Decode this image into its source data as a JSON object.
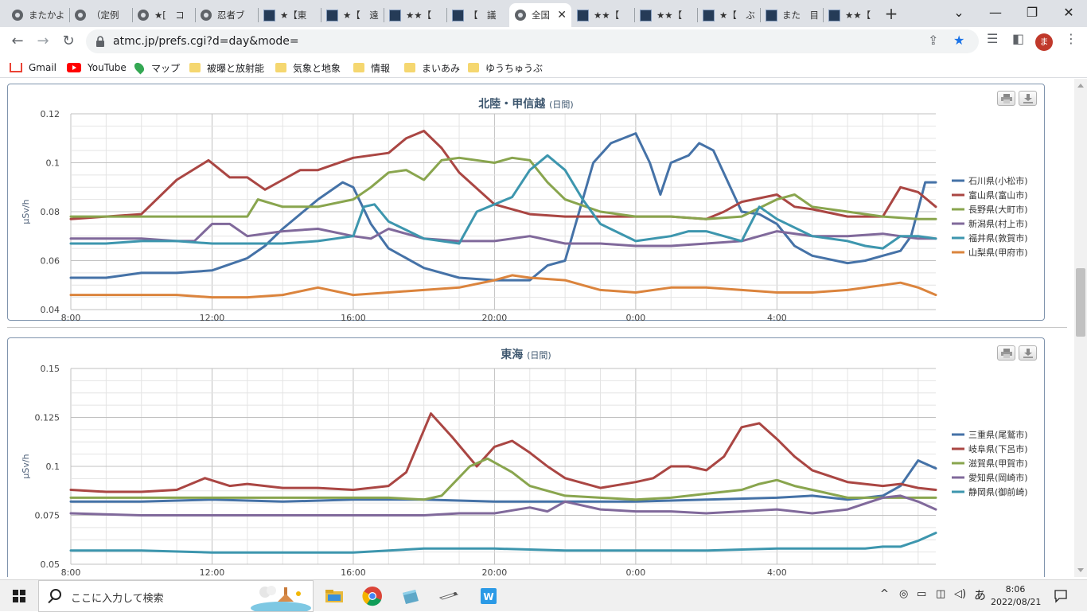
{
  "browser": {
    "tabs": [
      {
        "title": "またかよ",
        "icon": "globe-icon",
        "active": false
      },
      {
        "title": "（定例",
        "icon": "globe-icon",
        "active": false
      },
      {
        "title": "★[　コ",
        "icon": "globe-icon",
        "active": false
      },
      {
        "title": "忍者ブ",
        "icon": "globe-icon",
        "active": false
      },
      {
        "title": "★【東",
        "icon": "site-icon",
        "active": false
      },
      {
        "title": "★【　遠",
        "icon": "site-icon",
        "active": false
      },
      {
        "title": "★★【",
        "icon": "site-icon",
        "active": false
      },
      {
        "title": "【　議",
        "icon": "site-icon",
        "active": false
      },
      {
        "title": "全国",
        "icon": "globe-icon",
        "active": true
      },
      {
        "title": "★★【",
        "icon": "site-icon",
        "active": false
      },
      {
        "title": "★★【",
        "icon": "site-icon",
        "active": false
      },
      {
        "title": "★【　ぶ",
        "icon": "site-icon",
        "active": false
      },
      {
        "title": "また　目",
        "icon": "site-icon",
        "active": false
      },
      {
        "title": "★★【",
        "icon": "site-icon",
        "active": false
      }
    ],
    "url": "atmc.jp/prefs.cgi?d=day&mode=",
    "avatar_letter": "ま",
    "bookmarks": [
      {
        "label": "Gmail",
        "icon": "gmail-icon"
      },
      {
        "label": "YouTube",
        "icon": "youtube-icon"
      },
      {
        "label": "マップ",
        "icon": "maps-icon"
      },
      {
        "label": "被曝と放射能",
        "icon": "folder-icon"
      },
      {
        "label": "気象と地象",
        "icon": "folder-icon"
      },
      {
        "label": "情報",
        "icon": "folder-icon"
      },
      {
        "label": "まいあみ",
        "icon": "folder-icon"
      },
      {
        "label": "ゆうちゅうぶ",
        "icon": "folder-icon"
      }
    ]
  },
  "chart_data": [
    {
      "type": "line",
      "title": "北陸・甲信越",
      "subtitle": "(日間)",
      "ylabel": "µSv/h",
      "ylim": [
        0.04,
        0.12
      ],
      "yticks": [
        "0.12",
        "0.1",
        "0.08",
        "0.06",
        "0.04"
      ],
      "ytick_values": [
        0.12,
        0.1,
        0.08,
        0.06,
        0.04
      ],
      "xlim": [
        8,
        32.5
      ],
      "xtick_labels": [
        "8:00",
        "12:00",
        "16:00",
        "20:00",
        "0:00",
        "4:00"
      ],
      "xtick_hours": [
        8,
        12,
        16,
        20,
        24,
        28
      ],
      "legend_position": "right",
      "series": [
        {
          "name": "石川県(小松市)",
          "color": "#4572a7",
          "x": [
            8,
            9,
            10,
            11,
            12,
            13,
            13.5,
            14,
            15,
            15.7,
            16,
            16.5,
            17,
            18,
            19,
            20,
            21,
            21.5,
            22,
            22.8,
            23.3,
            24,
            24.4,
            24.7,
            25,
            25.5,
            25.8,
            26.2,
            27,
            27.5,
            28,
            28.5,
            29,
            30,
            30.5,
            31,
            31.5,
            31.8,
            32.2,
            32.5
          ],
          "y": [
            0.053,
            0.053,
            0.055,
            0.055,
            0.056,
            0.061,
            0.066,
            0.073,
            0.085,
            0.092,
            0.09,
            0.075,
            0.065,
            0.057,
            0.053,
            0.052,
            0.052,
            0.058,
            0.06,
            0.1,
            0.108,
            0.112,
            0.1,
            0.087,
            0.1,
            0.103,
            0.108,
            0.105,
            0.08,
            0.079,
            0.075,
            0.066,
            0.062,
            0.059,
            0.06,
            0.062,
            0.064,
            0.07,
            0.092,
            0.092
          ]
        },
        {
          "name": "富山県(富山市)",
          "color": "#aa4643",
          "x": [
            8,
            9,
            10,
            11,
            11.9,
            12.5,
            13,
            13.5,
            14,
            14.5,
            15,
            16,
            17,
            17.5,
            18,
            18.5,
            19,
            20,
            21,
            22,
            23,
            24,
            25,
            26,
            26.5,
            27,
            28,
            28.5,
            29,
            30,
            31,
            31.5,
            32,
            32.5
          ],
          "y": [
            0.077,
            0.078,
            0.079,
            0.093,
            0.101,
            0.094,
            0.094,
            0.089,
            0.093,
            0.097,
            0.097,
            0.102,
            0.104,
            0.11,
            0.113,
            0.106,
            0.096,
            0.083,
            0.079,
            0.078,
            0.078,
            0.078,
            0.078,
            0.077,
            0.08,
            0.084,
            0.087,
            0.082,
            0.081,
            0.078,
            0.078,
            0.09,
            0.088,
            0.082
          ]
        },
        {
          "name": "長野県(大町市)",
          "color": "#89a54e",
          "x": [
            8,
            9,
            10,
            11,
            12,
            13,
            13.3,
            14,
            15,
            16,
            16.5,
            17,
            17.5,
            18,
            18.5,
            19,
            20,
            20.5,
            21,
            21.5,
            22,
            23,
            24,
            25,
            26,
            27,
            28,
            28.5,
            29,
            30,
            31,
            32,
            32.5
          ],
          "y": [
            0.078,
            0.078,
            0.078,
            0.078,
            0.078,
            0.078,
            0.085,
            0.082,
            0.082,
            0.085,
            0.09,
            0.096,
            0.097,
            0.093,
            0.101,
            0.102,
            0.1,
            0.102,
            0.101,
            0.092,
            0.085,
            0.08,
            0.078,
            0.078,
            0.077,
            0.078,
            0.085,
            0.087,
            0.082,
            0.08,
            0.078,
            0.077,
            0.077
          ]
        },
        {
          "name": "新潟県(村上市)",
          "color": "#80699b",
          "x": [
            8,
            9,
            10,
            11,
            11.5,
            12,
            12.5,
            13,
            14,
            15,
            16,
            16.5,
            17,
            17.5,
            18,
            19,
            20,
            21,
            22,
            23,
            24,
            25,
            26,
            27,
            28,
            29,
            30,
            31,
            32,
            32.5
          ],
          "y": [
            0.069,
            0.069,
            0.069,
            0.068,
            0.068,
            0.075,
            0.075,
            0.07,
            0.072,
            0.073,
            0.07,
            0.069,
            0.073,
            0.071,
            0.069,
            0.068,
            0.068,
            0.07,
            0.067,
            0.067,
            0.066,
            0.066,
            0.067,
            0.068,
            0.072,
            0.07,
            0.07,
            0.071,
            0.069,
            0.069
          ]
        },
        {
          "name": "福井県(敦賀市)",
          "color": "#3d96ae",
          "x": [
            8,
            9,
            10,
            11,
            12,
            13,
            14,
            15,
            16,
            16.3,
            16.6,
            17,
            18,
            19,
            19.5,
            20,
            20.5,
            21,
            21.5,
            22,
            22.5,
            23,
            24,
            25,
            25.5,
            26,
            27,
            27.5,
            28,
            29,
            30,
            30.5,
            31,
            31.5,
            32,
            32.5
          ],
          "y": [
            0.067,
            0.067,
            0.068,
            0.068,
            0.067,
            0.067,
            0.067,
            0.068,
            0.07,
            0.082,
            0.083,
            0.076,
            0.069,
            0.067,
            0.08,
            0.083,
            0.086,
            0.097,
            0.103,
            0.097,
            0.085,
            0.075,
            0.068,
            0.07,
            0.072,
            0.072,
            0.068,
            0.082,
            0.077,
            0.07,
            0.068,
            0.066,
            0.065,
            0.07,
            0.07,
            0.069
          ]
        },
        {
          "name": "山梨県(甲府市)",
          "color": "#db843d",
          "x": [
            8,
            9,
            10,
            11,
            12,
            13,
            14,
            15,
            16,
            17,
            18,
            19,
            20,
            20.5,
            21,
            22,
            22.5,
            23,
            24,
            25,
            26,
            27,
            28,
            29,
            30,
            31,
            31.5,
            32,
            32.5
          ],
          "y": [
            0.046,
            0.046,
            0.046,
            0.046,
            0.045,
            0.045,
            0.046,
            0.049,
            0.046,
            0.047,
            0.048,
            0.049,
            0.052,
            0.054,
            0.053,
            0.052,
            0.05,
            0.048,
            0.047,
            0.049,
            0.049,
            0.048,
            0.047,
            0.047,
            0.048,
            0.05,
            0.051,
            0.049,
            0.046
          ]
        }
      ]
    },
    {
      "type": "line",
      "title": "東海",
      "subtitle": "(日間)",
      "ylabel": "µSv/h",
      "ylim": [
        0.05,
        0.15
      ],
      "yticks": [
        "0.15",
        "0.125",
        "0.1",
        "0.075",
        "0.05"
      ],
      "ytick_values": [
        0.15,
        0.125,
        0.1,
        0.075,
        0.05
      ],
      "xlim": [
        8,
        32.5
      ],
      "xtick_labels": [
        "8:00",
        "12:00",
        "16:00",
        "20:00",
        "0:00",
        "4:00"
      ],
      "xtick_hours": [
        8,
        12,
        16,
        20,
        24,
        28
      ],
      "legend_position": "right",
      "series": [
        {
          "name": "三重県(尾鷲市)",
          "color": "#4572a7",
          "x": [
            8,
            10,
            12,
            14,
            16,
            18,
            20,
            22,
            24,
            26,
            28,
            29,
            30,
            30.5,
            31,
            31.5,
            32,
            32.5
          ],
          "y": [
            0.082,
            0.082,
            0.083,
            0.082,
            0.083,
            0.083,
            0.082,
            0.082,
            0.082,
            0.083,
            0.084,
            0.085,
            0.083,
            0.084,
            0.085,
            0.09,
            0.103,
            0.099
          ]
        },
        {
          "name": "岐阜県(下呂市)",
          "color": "#aa4643",
          "x": [
            8,
            9,
            10,
            11,
            11.8,
            12.5,
            13,
            14,
            15,
            16,
            17,
            17.5,
            18.2,
            18.8,
            19.5,
            20,
            20.5,
            21,
            21.5,
            22,
            23,
            24,
            24.5,
            25,
            25.5,
            26,
            26.5,
            27,
            27.5,
            28,
            28.5,
            29,
            29.5,
            30,
            31,
            31.5,
            32,
            32.5
          ],
          "y": [
            0.088,
            0.087,
            0.087,
            0.088,
            0.094,
            0.09,
            0.091,
            0.089,
            0.089,
            0.088,
            0.09,
            0.097,
            0.127,
            0.115,
            0.1,
            0.11,
            0.113,
            0.107,
            0.1,
            0.094,
            0.089,
            0.092,
            0.094,
            0.1,
            0.1,
            0.098,
            0.105,
            0.12,
            0.122,
            0.114,
            0.105,
            0.098,
            0.095,
            0.092,
            0.09,
            0.091,
            0.089,
            0.088
          ]
        },
        {
          "name": "滋賀県(甲賀市)",
          "color": "#89a54e",
          "x": [
            8,
            10,
            12,
            14,
            16,
            17,
            18,
            18.5,
            19.3,
            19.8,
            20.5,
            21,
            22,
            23,
            24,
            25,
            26,
            27,
            27.5,
            28,
            28.5,
            29,
            30,
            31,
            32,
            32.5
          ],
          "y": [
            0.084,
            0.084,
            0.084,
            0.084,
            0.084,
            0.084,
            0.083,
            0.085,
            0.1,
            0.104,
            0.097,
            0.09,
            0.085,
            0.084,
            0.083,
            0.084,
            0.086,
            0.088,
            0.091,
            0.093,
            0.09,
            0.088,
            0.084,
            0.084,
            0.084,
            0.084
          ]
        },
        {
          "name": "愛知県(岡崎市)",
          "color": "#80699b",
          "x": [
            8,
            10,
            12,
            14,
            16,
            18,
            19,
            20,
            21,
            21.5,
            22,
            23,
            24,
            25,
            26,
            27,
            28,
            29,
            30,
            30.5,
            31,
            31.5,
            32,
            32.5
          ],
          "y": [
            0.076,
            0.075,
            0.075,
            0.075,
            0.075,
            0.075,
            0.076,
            0.076,
            0.079,
            0.077,
            0.082,
            0.078,
            0.077,
            0.077,
            0.076,
            0.077,
            0.078,
            0.076,
            0.078,
            0.081,
            0.084,
            0.085,
            0.082,
            0.078
          ]
        },
        {
          "name": "静岡県(御前崎)",
          "color": "#3d96ae",
          "x": [
            8,
            10,
            12,
            14,
            16,
            18,
            20,
            22,
            24,
            26,
            28,
            30,
            30.5,
            31,
            31.5,
            32,
            32.5
          ],
          "y": [
            0.057,
            0.057,
            0.056,
            0.056,
            0.056,
            0.058,
            0.058,
            0.057,
            0.057,
            0.057,
            0.058,
            0.058,
            0.058,
            0.059,
            0.059,
            0.062,
            0.066
          ]
        }
      ]
    }
  ],
  "taskbar": {
    "search_placeholder": "ここに入力して検索",
    "ime": "あ",
    "time": "8:06",
    "date": "2022/08/21"
  }
}
